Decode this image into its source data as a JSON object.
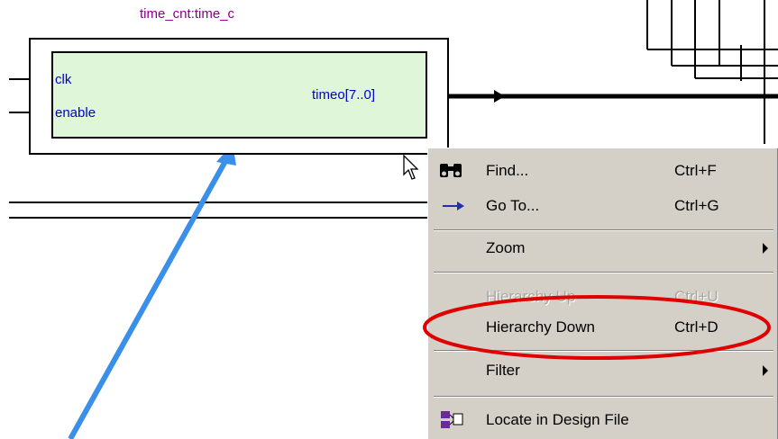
{
  "block": {
    "title": "time_cnt:time_c",
    "ports": {
      "clk": "clk",
      "enable": "enable",
      "timeo": "timeo[7..0]"
    }
  },
  "context_menu": {
    "items": [
      {
        "label": "Find...",
        "mnemonic": "F",
        "shortcut": "Ctrl+F",
        "icon": "binoculars-icon",
        "enabled": true
      },
      {
        "label": "Go To...",
        "mnemonic": "G",
        "shortcut": "Ctrl+G",
        "icon": "arrow-right-icon",
        "enabled": true
      },
      {
        "label": "Zoom",
        "mnemonic": "Z",
        "shortcut": "",
        "submenu": true,
        "enabled": true
      },
      {
        "label": "Hierarchy Up",
        "shortcut": "Ctrl+U",
        "enabled": false
      },
      {
        "label": "Hierarchy Down",
        "mnemonic": "D",
        "shortcut": "Ctrl+D",
        "enabled": true
      },
      {
        "label": "Filter",
        "mnemonic": "F",
        "shortcut": "",
        "submenu": true,
        "enabled": true
      },
      {
        "label": "Locate in Design File",
        "mnemonic": "D",
        "shortcut": "",
        "icon": "locate-file-icon",
        "enabled": true
      }
    ]
  },
  "colors": {
    "block_fill": "#dff6d8",
    "port_text": "#0000c8",
    "title_text": "#8b008b",
    "menu_bg": "#d4d0c8",
    "highlight_ellipse": "#e00000",
    "annotation_arrow": "#3a8fe8"
  }
}
